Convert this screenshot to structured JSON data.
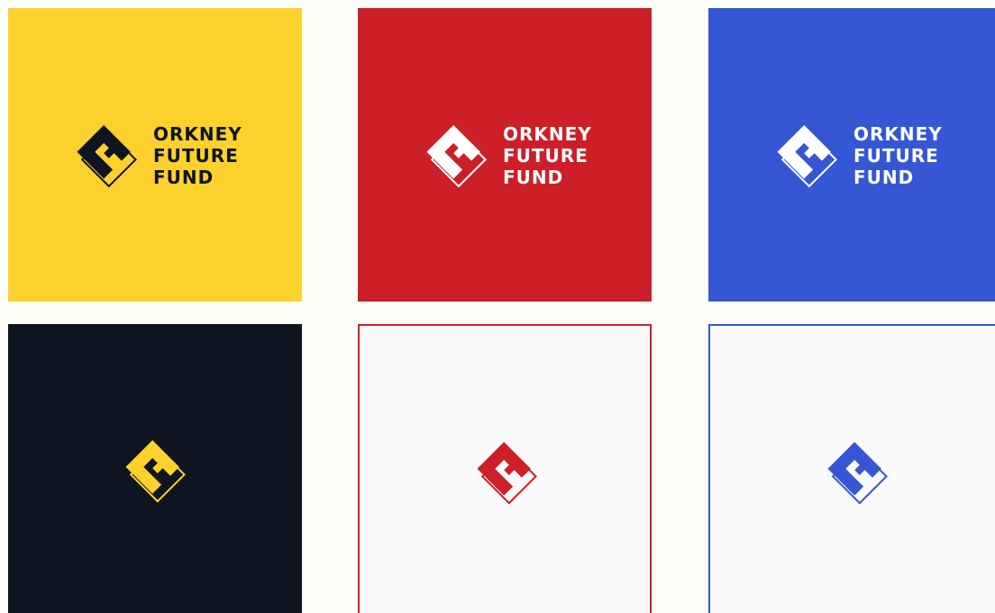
{
  "brand": {
    "line1": "ORKNEY",
    "line2": "FUTURE",
    "line3": "FUND"
  },
  "colors": {
    "yellow": "#fdd12d",
    "red": "#cc1f27",
    "blue": "#3657d4",
    "navy": "#0e1420",
    "paper": "#fafafd",
    "white": "#ffffff"
  },
  "tiles": [
    {
      "name": "yellow-lockup",
      "background": "#fdd12d",
      "mark_color": "#0e1420",
      "text_color": "#0e1420"
    },
    {
      "name": "red-lockup",
      "background": "#cc1f27",
      "mark_color": "#ffffff",
      "text_color": "#ffffff"
    },
    {
      "name": "blue-lockup",
      "background": "#3657d4",
      "mark_color": "#ffffff",
      "text_color": "#ffffff"
    },
    {
      "name": "navy-mark",
      "background": "#0e1420",
      "mark_color": "#fdd12d"
    },
    {
      "name": "red-outline-mark",
      "background": "#fafafd",
      "mark_color": "#cc1f27",
      "border": "#cc1f27"
    },
    {
      "name": "blue-outline-mark",
      "background": "#fafafd",
      "mark_color": "#3657d4",
      "border": "#3657d4"
    }
  ]
}
